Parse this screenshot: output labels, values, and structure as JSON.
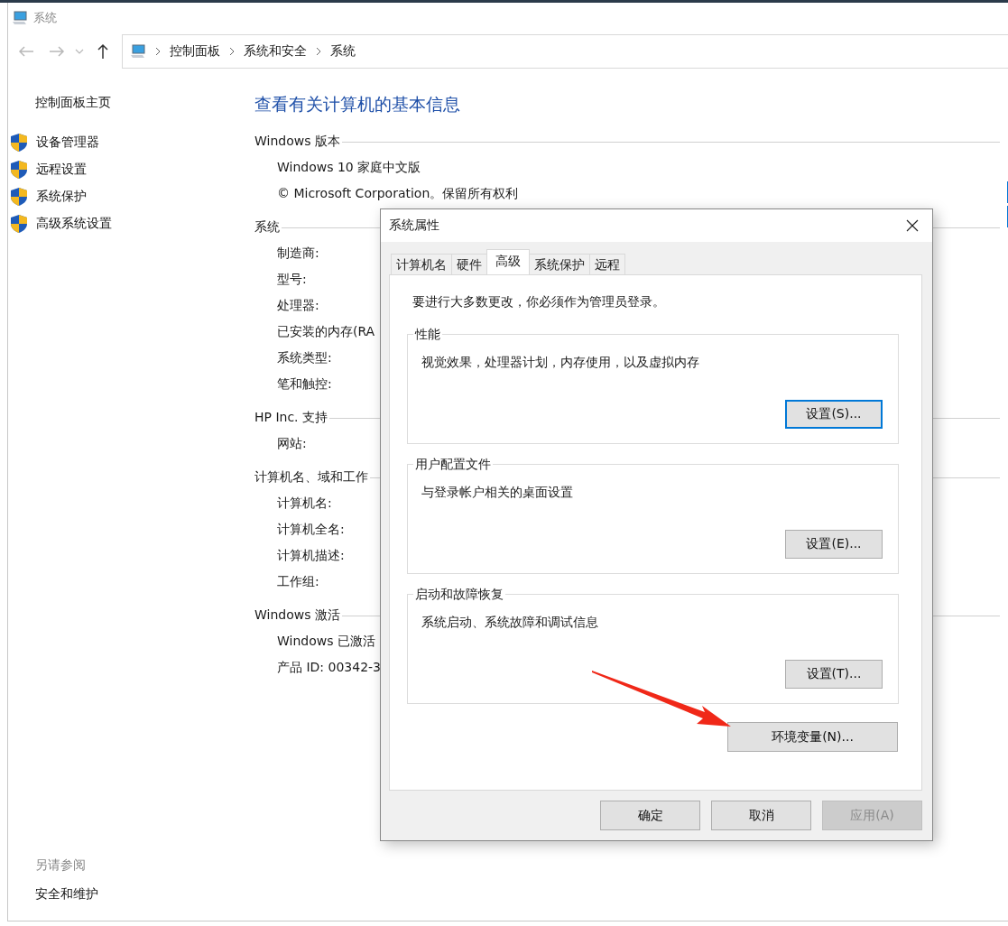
{
  "window": {
    "title": "系统"
  },
  "breadcrumb": [
    "控制面板",
    "系统和安全",
    "系统"
  ],
  "sidebar": {
    "home": "控制面板主页",
    "items": [
      {
        "label": "设备管理器"
      },
      {
        "label": "远程设置"
      },
      {
        "label": "系统保护"
      },
      {
        "label": "高级系统设置"
      }
    ],
    "see_also": {
      "heading": "另请参阅",
      "links": [
        "安全和维护"
      ]
    }
  },
  "main": {
    "heading": "查看有关计算机的基本信息",
    "sections": [
      {
        "title": "Windows 版本",
        "rows": [
          "Windows 10 家庭中文版",
          "© Microsoft Corporation。保留所有权利"
        ]
      },
      {
        "title": "系统",
        "rows": [
          "制造商:",
          "型号:",
          "处理器:",
          "已安装的内存(RA",
          "系统类型:",
          "笔和触控:"
        ]
      },
      {
        "title": "HP Inc. 支持",
        "rows": [
          "网站:"
        ]
      },
      {
        "title": "计算机名、域和工作",
        "rows": [
          "计算机名:",
          "计算机全名:",
          "计算机描述:",
          "工作组:"
        ]
      },
      {
        "title": "Windows 激活",
        "rows": [
          "Windows 已激活",
          "产品 ID: 00342-3"
        ]
      }
    ]
  },
  "dialog": {
    "title": "系统属性",
    "tabs": [
      {
        "label": "计算机名",
        "selected": false
      },
      {
        "label": "硬件",
        "selected": false
      },
      {
        "label": "高级",
        "selected": true
      },
      {
        "label": "系统保护",
        "selected": false
      },
      {
        "label": "远程",
        "selected": false
      }
    ],
    "notice": "要进行大多数更改，你必须作为管理员登录。",
    "groups": [
      {
        "title": "性能",
        "description": "视觉效果，处理器计划，内存使用，以及虚拟内存",
        "button": {
          "label": "设置(S)...",
          "focused": true
        }
      },
      {
        "title": "用户配置文件",
        "description": "与登录帐户相关的桌面设置",
        "button": {
          "label": "设置(E)...",
          "focused": false
        }
      },
      {
        "title": "启动和故障恢复",
        "description": "系统启动、系统故障和调试信息",
        "button": {
          "label": "设置(T)...",
          "focused": false
        }
      }
    ],
    "env_button": "环境变量(N)...",
    "footer": [
      {
        "label": "确定",
        "disabled": false
      },
      {
        "label": "取消",
        "disabled": false
      },
      {
        "label": "应用(A)",
        "disabled": true
      }
    ]
  }
}
